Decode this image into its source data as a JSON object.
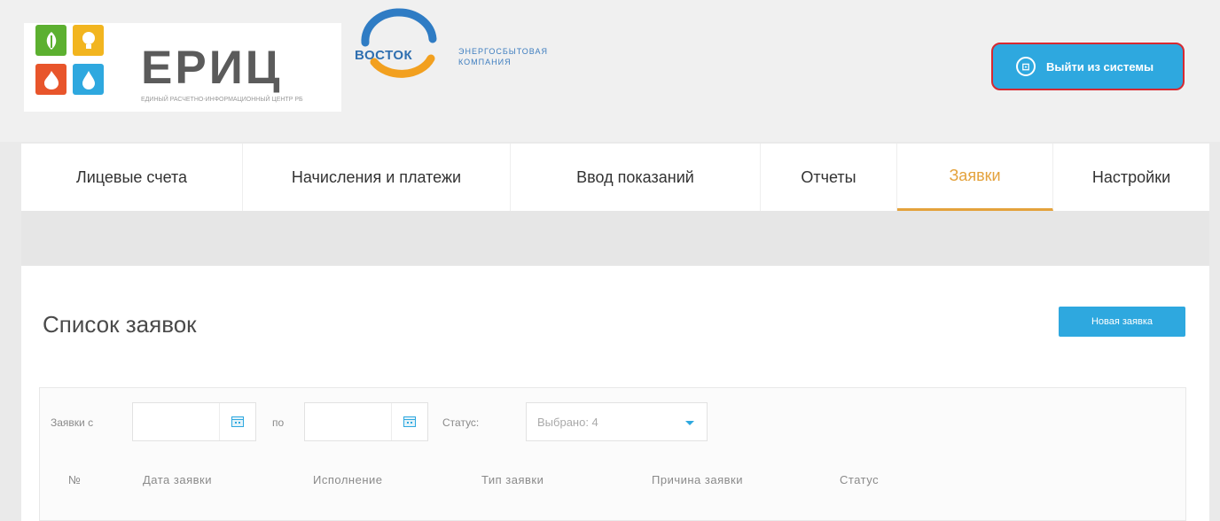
{
  "header": {
    "logo_text": "ЕРИЦ",
    "logo_subtitle": "ЕДИНЫЙ РАСЧЕТНО-ИНФОРМАЦИОННЫЙ ЦЕНТР РБ",
    "partner_logo_text": "ВОСТОК",
    "partner_subtitle": "ЭНЕРГОСБЫТОВАЯ КОМПАНИЯ",
    "logout_label": "Выйти из системы",
    "logout_icon_glyph": "⊡"
  },
  "nav": {
    "tabs": [
      {
        "label": "Лицевые счета"
      },
      {
        "label": "Начисления и платежи"
      },
      {
        "label": "Ввод показаний"
      },
      {
        "label": "Отчеты"
      },
      {
        "label": "Заявки"
      },
      {
        "label": "Настройки"
      }
    ],
    "active_tab": "Заявки"
  },
  "main": {
    "title": "Список заявок",
    "new_request_label": "Новая заявка",
    "filters": {
      "from_label": "Заявки с",
      "from_value": "",
      "to_label": "по",
      "to_value": "",
      "status_label": "Статус:",
      "status_value": "Выбрано: 4"
    },
    "table": {
      "columns": [
        "№",
        "Дата заявки",
        "Исполнение",
        "Тип заявки",
        "Причина заявки",
        "Статус"
      ]
    }
  },
  "colors": {
    "accent_blue": "#2ea8df",
    "active_tab": "#e4a23c",
    "highlight_red": "#d62931",
    "tile_green": "#5cb030",
    "tile_yellow": "#f2b51f",
    "tile_red": "#e8552b",
    "tile_blue": "#2ea8df"
  },
  "icons": {
    "tiles": [
      "leaf-icon",
      "lightbulb-icon",
      "flame-icon",
      "water-drop-icon"
    ],
    "calendar": "calendar-icon",
    "logout": "logout-icon",
    "dropdown": "chevron-down-icon"
  }
}
